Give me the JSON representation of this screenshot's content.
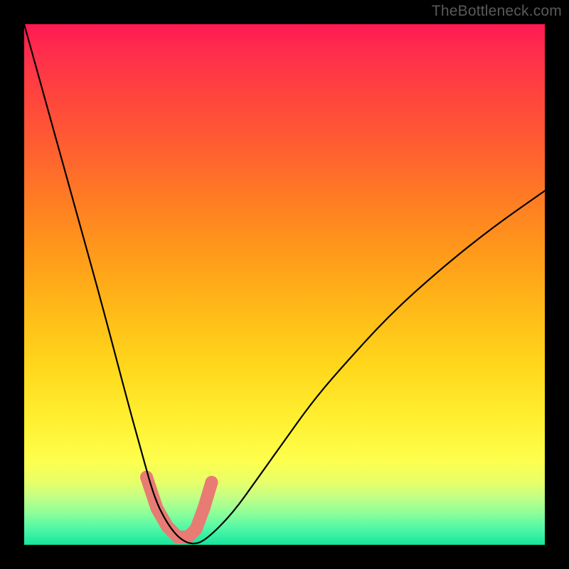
{
  "watermark": "TheBottleneck.com",
  "chart_data": {
    "type": "line",
    "title": "",
    "xlabel": "",
    "ylabel": "",
    "x_range_normalized": [
      0,
      1
    ],
    "y_range_percent": [
      0,
      100
    ],
    "background_gradient": {
      "top_color": "#ff1a52",
      "bottom_color": "#15e59c",
      "meaning": "x-position sweep; red high at edges to green low at valley"
    },
    "series": [
      {
        "name": "bottleneck-curve",
        "color": "#000000",
        "x": [
          0.0,
          0.05,
          0.1,
          0.15,
          0.2,
          0.225,
          0.25,
          0.275,
          0.3,
          0.325,
          0.35,
          0.4,
          0.45,
          0.5,
          0.55,
          0.6,
          0.7,
          0.8,
          0.9,
          1.0
        ],
        "y": [
          100,
          82,
          64,
          46,
          27,
          18,
          9,
          4,
          1,
          0,
          1,
          6,
          13,
          20,
          27,
          33,
          44,
          53,
          61,
          68
        ]
      }
    ],
    "markers": {
      "name": "highlight-near-minimum",
      "color": "#e87b74",
      "points_x": [
        0.235,
        0.255,
        0.275,
        0.295,
        0.315,
        0.33,
        0.345,
        0.36
      ],
      "points_y": [
        13,
        7,
        3.5,
        1.5,
        1.5,
        3,
        7,
        12
      ],
      "radius_px": 9
    }
  }
}
